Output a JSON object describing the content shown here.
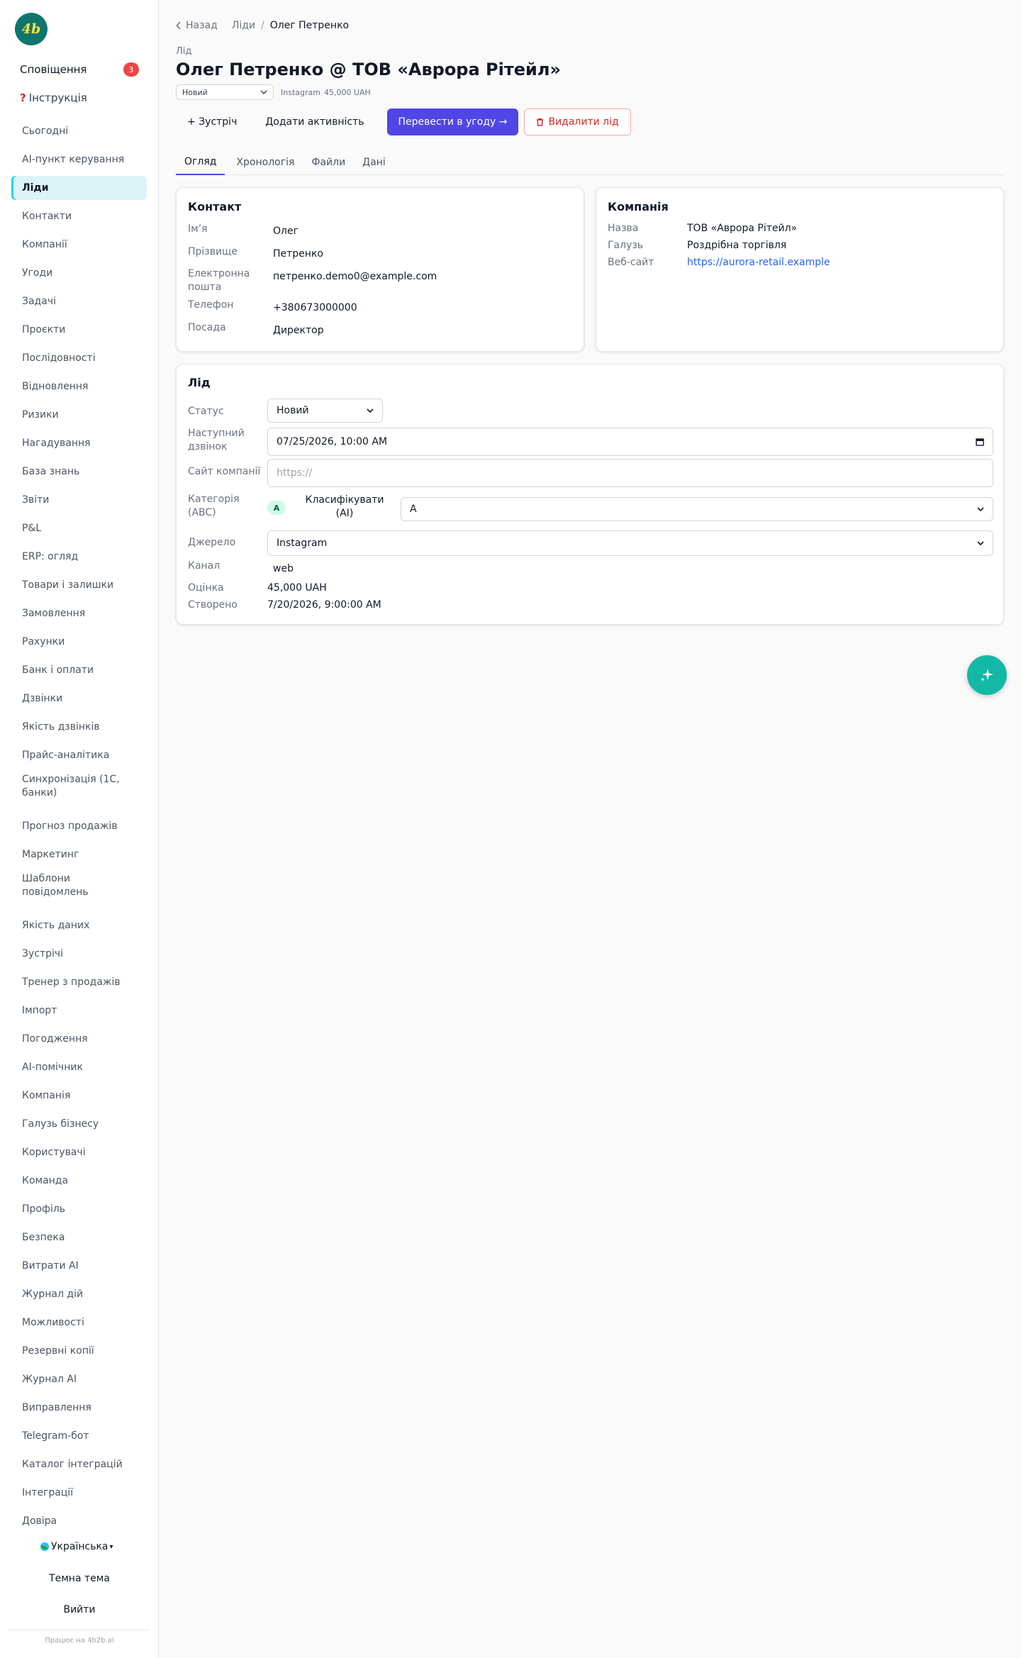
{
  "logo": {
    "text": "4b"
  },
  "notifications": {
    "label": "Сповіщення",
    "count": "3"
  },
  "instructions": {
    "label": "Інструкція"
  },
  "nav": [
    "Сьогодні",
    "AI-пункт керування",
    "Ліди",
    "Контакти",
    "Компанії",
    "Угоди",
    "Задачі",
    "Проєкти",
    "Послідовності",
    "Відновлення",
    "Ризики",
    "Нагадування",
    "База знань",
    "Звіти",
    "P&L",
    "ERP: огляд",
    "Товари і залишки",
    "Замовлення",
    "Рахунки",
    "Банк і оплати",
    "Дзвінки",
    "Якість дзвінків",
    "Прайс-аналітика",
    "Синхронізація (1С, банки)",
    "Прогноз продажів",
    "Маркетинг",
    "Шаблони повідомлень",
    "Якість даних",
    "Зустрічі",
    "Тренер з продажів",
    "Імпорт",
    "Погодження",
    "AI-помічник",
    "Компанія",
    "Галузь бізнесу",
    "Користувачі",
    "Команда",
    "Профіль",
    "Безпека",
    "Витрати AI",
    "Журнал дій",
    "Можливості",
    "Резервні копії",
    "Журнал AI",
    "Виправлення",
    "Telegram-бот",
    "Каталог інтеграцій",
    "Інтеграції",
    "Довіра"
  ],
  "nav_active_index": 2,
  "language": {
    "label": "Українська"
  },
  "theme": {
    "label": "Темна тема"
  },
  "logout": {
    "label": "Вийти"
  },
  "powered_by": "Працює на 4b2b.ai",
  "breadcrumb": {
    "back": "Назад",
    "section": "Ліди",
    "current": "Олег Петренко"
  },
  "header": {
    "kind": "Лід",
    "title": "Олег Петренко @ ТОВ «Аврора Рітейл»",
    "status": "Новий",
    "source": "Instagram",
    "amount": "45,000 UAH"
  },
  "actions": {
    "meeting": "+ Зустріч",
    "add_activity": "Додати активність",
    "convert": "Перевести в угоду →",
    "delete": "Видалити лід"
  },
  "tabs": [
    "Огляд",
    "Хронологія",
    "Файли",
    "Дані"
  ],
  "contact": {
    "title": "Контакт",
    "rows": [
      {
        "label": "Ім’я",
        "value": "Олег"
      },
      {
        "label": "Прізвище",
        "value": "Петренко"
      },
      {
        "label": "Електронна пошта",
        "value": "петренко.demo0@example.com"
      },
      {
        "label": "Телефон",
        "value": "+380673000000"
      },
      {
        "label": "Посада",
        "value": "Директор"
      }
    ]
  },
  "company": {
    "title": "Компанія",
    "rows": [
      {
        "label": "Назва",
        "value": "ТОВ «Аврора Рітейл»"
      },
      {
        "label": "Галузь",
        "value": "Роздрібна торгівля"
      },
      {
        "label": "Веб-сайт",
        "value": "https://aurora-retail.example"
      }
    ]
  },
  "lead": {
    "title": "Лід",
    "status_label": "Статус",
    "status_value": "Новий",
    "next_call_label": "Наступний дзвінок",
    "next_call_value": "07/25/2026, 10:00 AM",
    "site_label": "Сайт компанії",
    "site_placeholder": "https://",
    "category_label": "Категорія (ABC)",
    "category_badge": "A",
    "classify_label": "Класифікувати (AI)",
    "classify_value": "A",
    "source_label": "Джерело",
    "source_value": "Instagram",
    "channel_label": "Канал",
    "channel_value": "web",
    "estimate_label": "Оцінка",
    "estimate_value": "45,000 UAH",
    "created_label": "Створено",
    "created_value": "7/20/2026, 9:00:00 AM"
  },
  "icons": {
    "back": "chevron-left-icon",
    "trash": "trash-icon",
    "globe": "globe-icon",
    "calendar": "calendar-icon",
    "chevron": "chevron-down-icon",
    "fab": "sparkles-icon"
  },
  "colors": {
    "accent": "#4f46e5",
    "teal": "#14b8a6",
    "danger": "#dc2626",
    "link": "#2563eb",
    "active_nav_bg": "#dcf3f8"
  }
}
